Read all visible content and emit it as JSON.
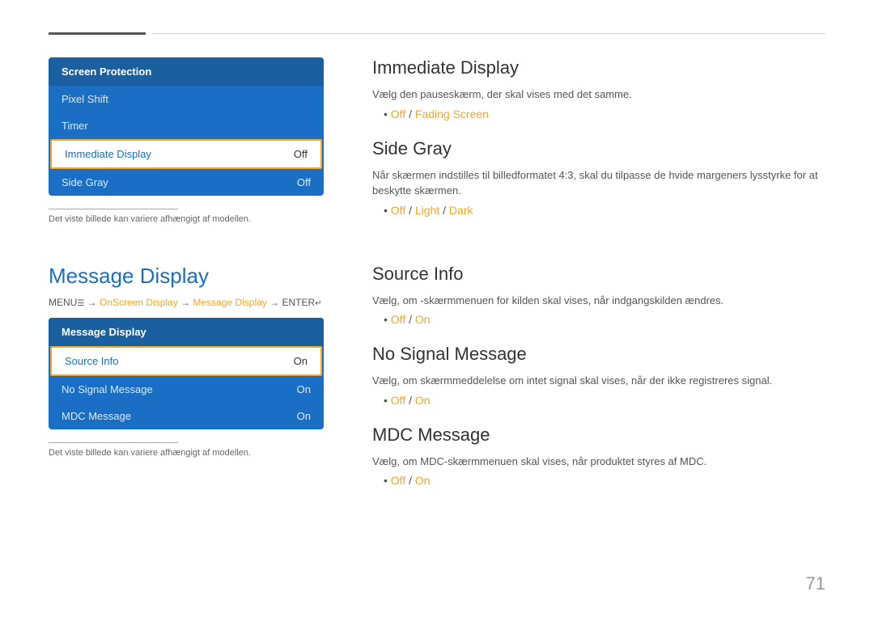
{
  "topDividers": true,
  "topSection": {
    "menu": {
      "header": "Screen Protection",
      "items": [
        {
          "label": "Pixel Shift",
          "value": "",
          "active": false
        },
        {
          "label": "Timer",
          "value": "",
          "active": false
        },
        {
          "label": "Immediate Display",
          "value": "Off",
          "active": true
        },
        {
          "label": "Side Gray",
          "value": "Off",
          "active": false
        }
      ]
    },
    "note": "Det viste billede kan variere afhængigt af modellen.",
    "rightSections": [
      {
        "id": "immediate-display",
        "title": "Immediate Display",
        "body": "Vælg den pauseskærm, der skal vises med det samme.",
        "bulletText": "Off / Fading Screen",
        "bulletOrange": [
          "Off",
          "Fading Screen"
        ],
        "bulletSlashes": [
          " / "
        ]
      },
      {
        "id": "side-gray",
        "title": "Side Gray",
        "body": "Når skærmen indstilles til billedformatet 4:3, skal du tilpasse de hvide margeners lysstyrke for at beskytte skærmen.",
        "bulletText": "Off / Light / Dark",
        "bulletOrange": [
          "Off",
          "Light",
          "Dark"
        ],
        "bulletSlashes": [
          " / ",
          " / "
        ]
      }
    ]
  },
  "bottomSection": {
    "bigTitle": "Message Display",
    "menuPath": {
      "prefix": "MENU",
      "menuIcon": "☰",
      "parts": [
        {
          "text": " → ",
          "highlight": false
        },
        {
          "text": "OnScreen Display",
          "highlight": true
        },
        {
          "text": " → ",
          "highlight": false
        },
        {
          "text": "Message Display",
          "highlight": true
        },
        {
          "text": " → ENTER",
          "highlight": false
        },
        {
          "text": "↵",
          "highlight": false
        }
      ]
    },
    "menu": {
      "header": "Message Display",
      "items": [
        {
          "label": "Source Info",
          "value": "On",
          "active": true
        },
        {
          "label": "No Signal Message",
          "value": "On",
          "active": false
        },
        {
          "label": "MDC Message",
          "value": "On",
          "active": false
        }
      ]
    },
    "note": "Det viste billede kan variere afhængigt af modellen.",
    "rightSections": [
      {
        "id": "source-info",
        "title": "Source Info",
        "body": "Vælg, om -skærmmenuen for kilden skal vises, når indgangskilden ændres.",
        "bulletOrangeOff": "Off",
        "bulletSlash": " / ",
        "bulletOrangeOn": "On"
      },
      {
        "id": "no-signal-message",
        "title": "No Signal Message",
        "body": "Vælg, om skærmmeddelelse om intet signal skal vises, når der ikke registreres signal.",
        "bulletOrangeOff": "Off",
        "bulletSlash": " / ",
        "bulletOrangeOn": "On"
      },
      {
        "id": "mdc-message",
        "title": "MDC Message",
        "body": "Vælg, om MDC-skærmmenuen skal vises, når produktet styres af MDC.",
        "bulletOrangeOff": "Off",
        "bulletSlash": " / ",
        "bulletOrangeOn": "On"
      }
    ]
  },
  "pageNumber": "71"
}
